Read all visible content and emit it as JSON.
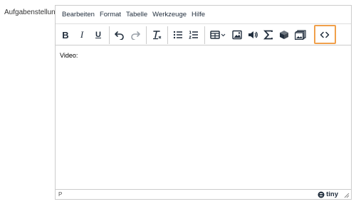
{
  "field": {
    "label": "Aufgabenstellung"
  },
  "menubar": {
    "items": [
      "Bearbeiten",
      "Format",
      "Tabelle",
      "Werkzeuge",
      "Hilfe"
    ]
  },
  "toolbar": {
    "buttons": [
      "bold",
      "italic",
      "underline",
      "undo",
      "redo",
      "clear-formatting",
      "bullet-list",
      "numbered-list",
      "table",
      "image",
      "media",
      "equation",
      "3d-model",
      "media-gallery",
      "source-code"
    ],
    "bold_label": "B",
    "italic_label": "I",
    "underline_label": "U",
    "highlighted": "source-code",
    "highlight_color": "#f0a04b"
  },
  "content": {
    "text": "Video:"
  },
  "statusbar": {
    "path": "P",
    "brand": "tiny"
  }
}
